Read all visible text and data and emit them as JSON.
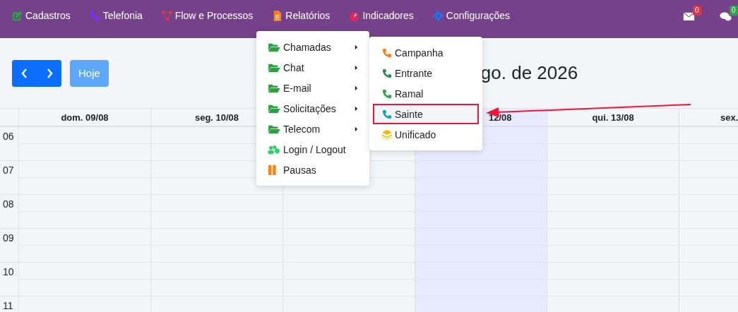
{
  "nav": [
    {
      "label": "Cadastros",
      "kind": "edit",
      "color": "#28a745"
    },
    {
      "label": "Telefonia",
      "kind": "phone",
      "color": "#7b2ff7"
    },
    {
      "label": "Flow e Processos",
      "kind": "sitemap",
      "color": "#dc3545"
    },
    {
      "label": "Relatórios",
      "kind": "file",
      "color": "#fd7e14"
    },
    {
      "label": "Indicadores",
      "kind": "gauge",
      "color": "#e0245e"
    },
    {
      "label": "Configurações",
      "kind": "gear",
      "color": "#1a73f0"
    }
  ],
  "notifications": [
    {
      "kind": "mail",
      "badge": "0",
      "color": "#dc3545"
    },
    {
      "kind": "chat",
      "badge": "0",
      "color": "#28a745"
    }
  ],
  "toolbar": {
    "today_button": "Hoje",
    "title": "go. de 2026"
  },
  "menu": [
    {
      "label": "Chamadas",
      "kind": "folder"
    },
    {
      "label": "Chat",
      "kind": "folder"
    },
    {
      "label": "E-mail",
      "kind": "folder"
    },
    {
      "label": "Solicitações",
      "kind": "folder"
    },
    {
      "label": "Telecom",
      "kind": "folder"
    },
    {
      "label": "Login / Logout",
      "kind": "users"
    },
    {
      "label": "Pausas",
      "kind": "pause"
    }
  ],
  "submenu": [
    {
      "label": "Campanha",
      "kind": "phone",
      "color": "#fd7e14",
      "selected": false
    },
    {
      "label": "Entrante",
      "kind": "phone",
      "color": "#2e8b57",
      "selected": false
    },
    {
      "label": "Ramal",
      "kind": "phone",
      "color": "#28a745",
      "selected": false
    },
    {
      "label": "Sainte",
      "kind": "phone",
      "color": "#17a2b8",
      "selected": true
    },
    {
      "label": "Unificado",
      "kind": "layers",
      "color": "#f5b800",
      "selected": false
    }
  ],
  "calendar": {
    "columns": [
      {
        "label": "dom. 09/08",
        "today": false,
        "kind": "full"
      },
      {
        "label": "seg. 10/08",
        "today": false,
        "kind": "full"
      },
      {
        "today": false,
        "kind": "full"
      },
      {
        "label": "12/08",
        "today": true,
        "kind": "cut-start"
      },
      {
        "label": "qui. 13/08",
        "today": false,
        "kind": "full"
      },
      {
        "label": "sex.",
        "today": false,
        "kind": "cut-end"
      }
    ],
    "hours": [
      "06",
      "07",
      "08",
      "09",
      "10",
      "11"
    ]
  }
}
